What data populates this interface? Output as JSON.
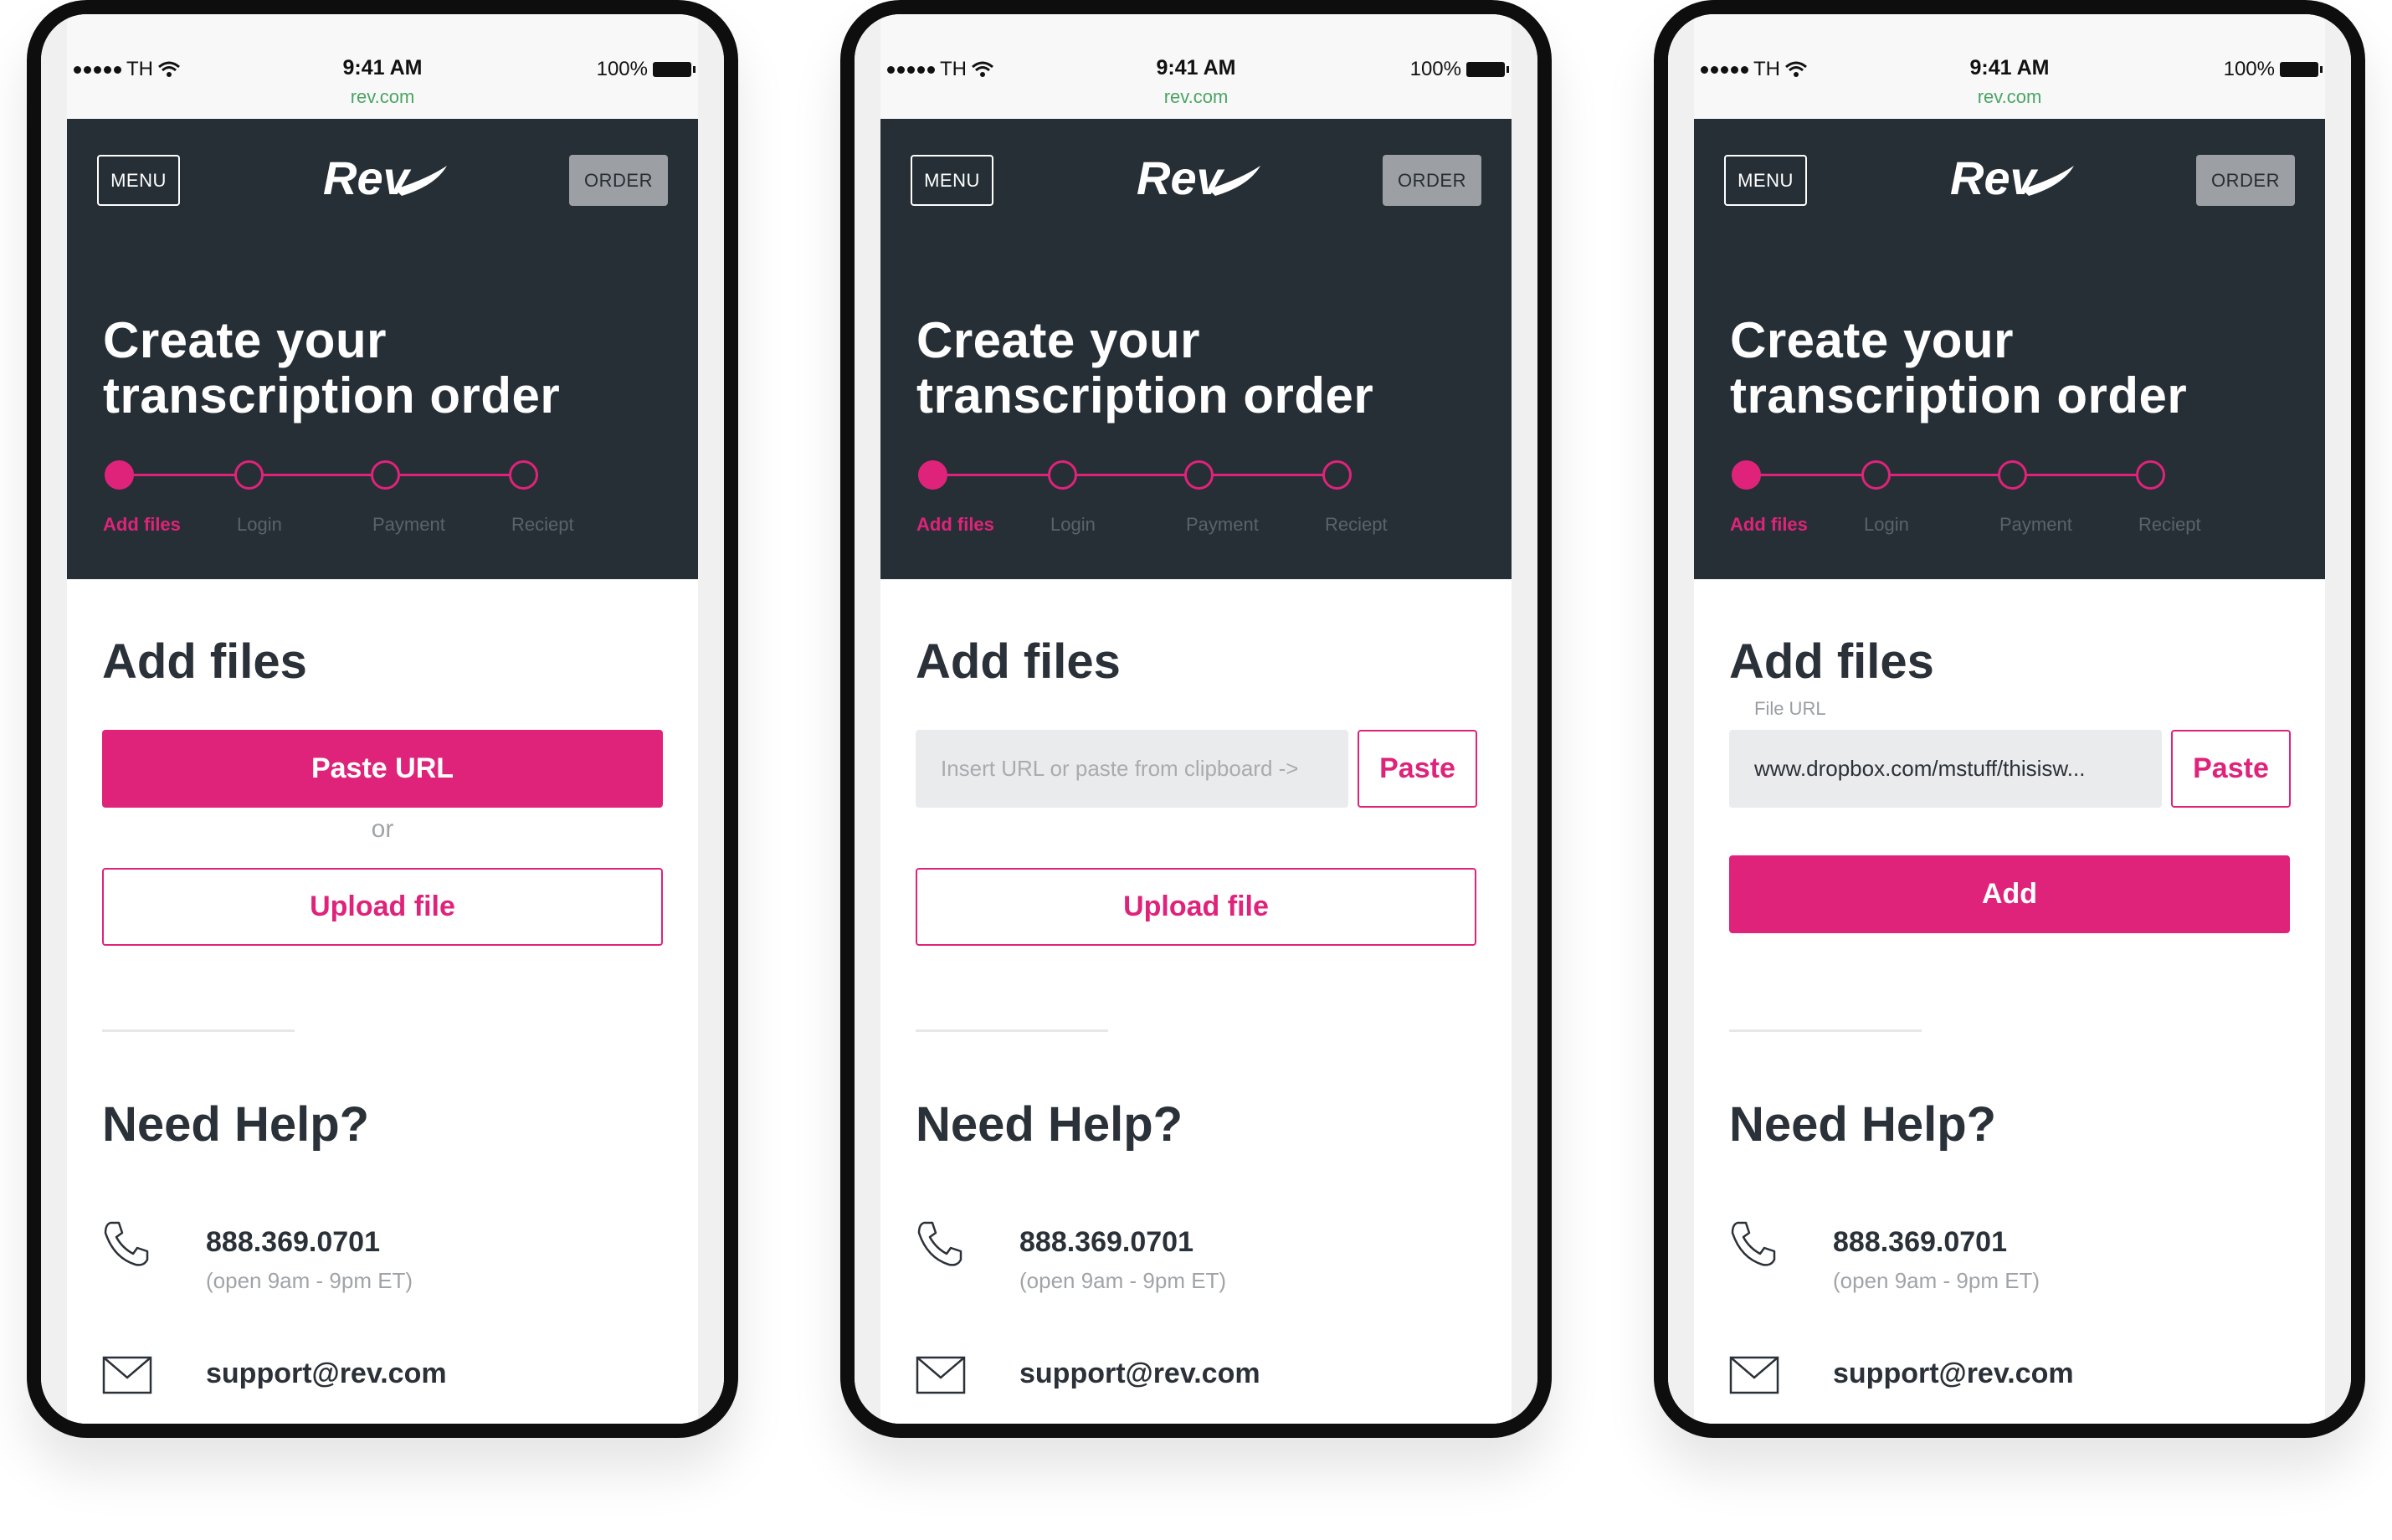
{
  "status_bar": {
    "carrier": "TH",
    "time": "9:41 AM",
    "url": "rev.com",
    "battery": "100%"
  },
  "nav": {
    "menu_label": "MENU",
    "order_label": "ORDER",
    "logo_text": "Rev"
  },
  "hero": {
    "title_line1": "Create your",
    "title_line2": "transcription order",
    "steps": [
      "Add files",
      "Login",
      "Payment",
      "Reciept"
    ],
    "active_step": 0
  },
  "add_files": {
    "heading": "Add files",
    "paste_url_label": "Paste URL",
    "or_label": "or",
    "upload_label": "Upload file",
    "url_placeholder": "Insert URL or paste from clipboard ->",
    "paste_label": "Paste",
    "file_url_label": "File URL",
    "file_url_value": "www.dropbox.com/mstuff/thisisw...",
    "add_label": "Add"
  },
  "help": {
    "heading": "Need Help?",
    "phone": "888.369.0701",
    "hours": "(open 9am - 9pm ET)",
    "email": "support@rev.com"
  },
  "colors": {
    "accent": "#e0237a",
    "dark": "#262f36",
    "gray_button": "#9c9fa3"
  }
}
